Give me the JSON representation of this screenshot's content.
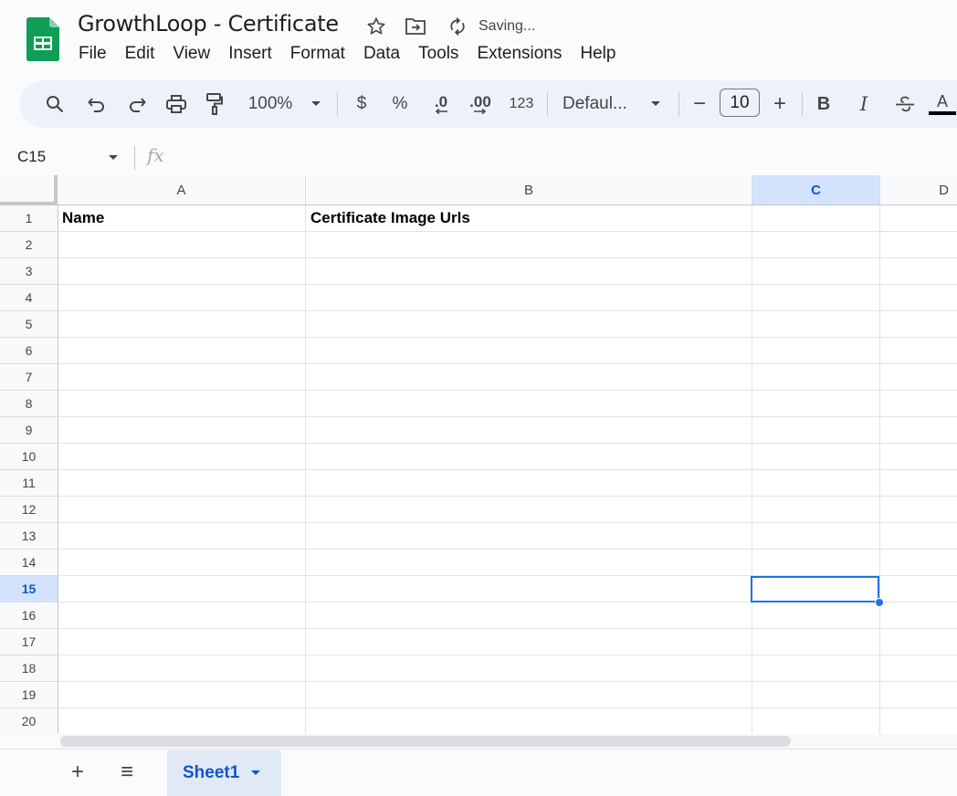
{
  "app": {
    "doc_title": "GrowthLoop - Certificate",
    "status": "Saving..."
  },
  "menu": [
    "File",
    "Edit",
    "View",
    "Insert",
    "Format",
    "Data",
    "Tools",
    "Extensions",
    "Help"
  ],
  "toolbar": {
    "zoom": "100%",
    "currency": "$",
    "percent": "%",
    "decrease_decimal": ".0",
    "increase_decimal": ".00",
    "number_format": "123",
    "font": "Defaul...",
    "font_size": "10",
    "decrease_font": "−",
    "increase_font": "+",
    "bold": "B",
    "italic": "I",
    "text_color": "A"
  },
  "formula_bar": {
    "name_box": "C15",
    "fx": "fx",
    "formula": ""
  },
  "grid": {
    "columns": [
      "A",
      "B",
      "C",
      "D"
    ],
    "selected_column": "C",
    "rows": [
      "1",
      "2",
      "3",
      "4",
      "5",
      "6",
      "7",
      "8",
      "9",
      "10",
      "11",
      "12",
      "13",
      "14",
      "15",
      "16",
      "17",
      "18",
      "19",
      "20"
    ],
    "selected_row": "15",
    "cells": {
      "A1": "Name",
      "B1": "Certificate Image Urls"
    },
    "active_cell": "C15"
  },
  "sheets": {
    "tabs": [
      {
        "label": "Sheet1",
        "active": true
      }
    ],
    "add_label": "+",
    "list_label": "≡"
  },
  "colors": {
    "accent": "#0b57d0",
    "selection": "#1a73e8",
    "header_selected_bg": "#d3e3fd",
    "sheets_green": "#0f9d58"
  }
}
